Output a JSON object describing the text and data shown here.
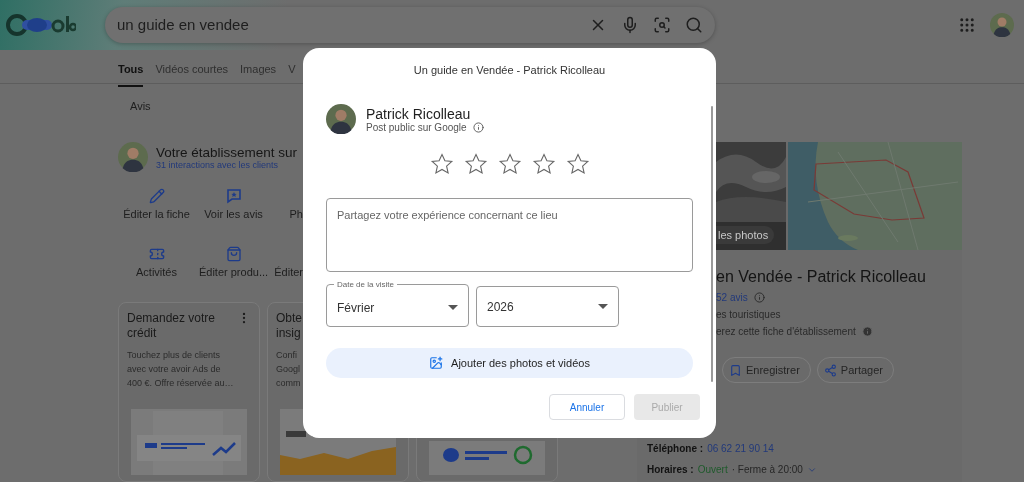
{
  "header": {
    "search": {
      "value": "un guide en vendee"
    }
  },
  "tabs": [
    {
      "label": "Tous",
      "selected": true
    },
    {
      "label": "Vidéos courtes",
      "selected": false
    },
    {
      "label": "Images",
      "selected": false
    },
    {
      "label": "V",
      "selected": false
    }
  ],
  "filter": "Avis",
  "business": {
    "title": "Votre établissement sur",
    "interactions": "31 interactions avec les clients",
    "actions": [
      {
        "label": "Éditer la fiche",
        "kind": "pencil"
      },
      {
        "label": "Voir les avis",
        "kind": "review"
      },
      {
        "label": "Ph",
        "kind": "partial"
      },
      {
        "label": "Activités",
        "kind": "ticket"
      },
      {
        "label": "Éditer produ...",
        "kind": "bag"
      },
      {
        "label": "Éditer",
        "kind": "partial"
      }
    ],
    "cards": [
      {
        "kind": "ads",
        "title_lines": [
          "Demandez votre",
          "crédit"
        ],
        "body_lines": [
          "Touchez plus de clients",
          "avec votre avoir Ads de",
          "400 €. Offre réservée au…"
        ],
        "menu": true
      },
      {
        "kind": "insights",
        "title_lines": [
          "Obte",
          "insig"
        ],
        "body_lines": [
          "Confi",
          "Googl",
          "comm"
        ]
      },
      {
        "kind": "messages"
      }
    ]
  },
  "knowledge": {
    "photos_button": "les photos",
    "title": "en Vendée - Patrick Ricolleau",
    "reviews": "52 avis",
    "category": "es touristiques",
    "manage": "erez cette fiche d'établissement",
    "buttons": [
      {
        "label": "Enregistrer",
        "kind": "bookmark"
      },
      {
        "label": "Partager",
        "kind": "share"
      }
    ],
    "facts": [
      {
        "kind": "link",
        "label": "Téléphone :",
        "value": "06 62 21 90 14"
      },
      {
        "kind": "hours",
        "label": "Horaires :",
        "value": "Ouvert",
        "extra": "· Ferme à 20:00"
      }
    ]
  },
  "modal": {
    "title": "Un guide en Vendée - Patrick Ricolleau",
    "author": "Patrick Ricolleau",
    "visibility": "Post public sur Google",
    "stars": 0,
    "review_placeholder": "Partagez votre expérience concernant ce lieu",
    "date_label": "Date de la visite",
    "month": "Février",
    "year": "2026",
    "add_media": "Ajouter des photos et vidéos",
    "buttons": [
      {
        "label": "Annuler",
        "kind": "outline",
        "disabled": false
      },
      {
        "label": "Publier",
        "kind": "filled",
        "disabled": true
      }
    ]
  }
}
